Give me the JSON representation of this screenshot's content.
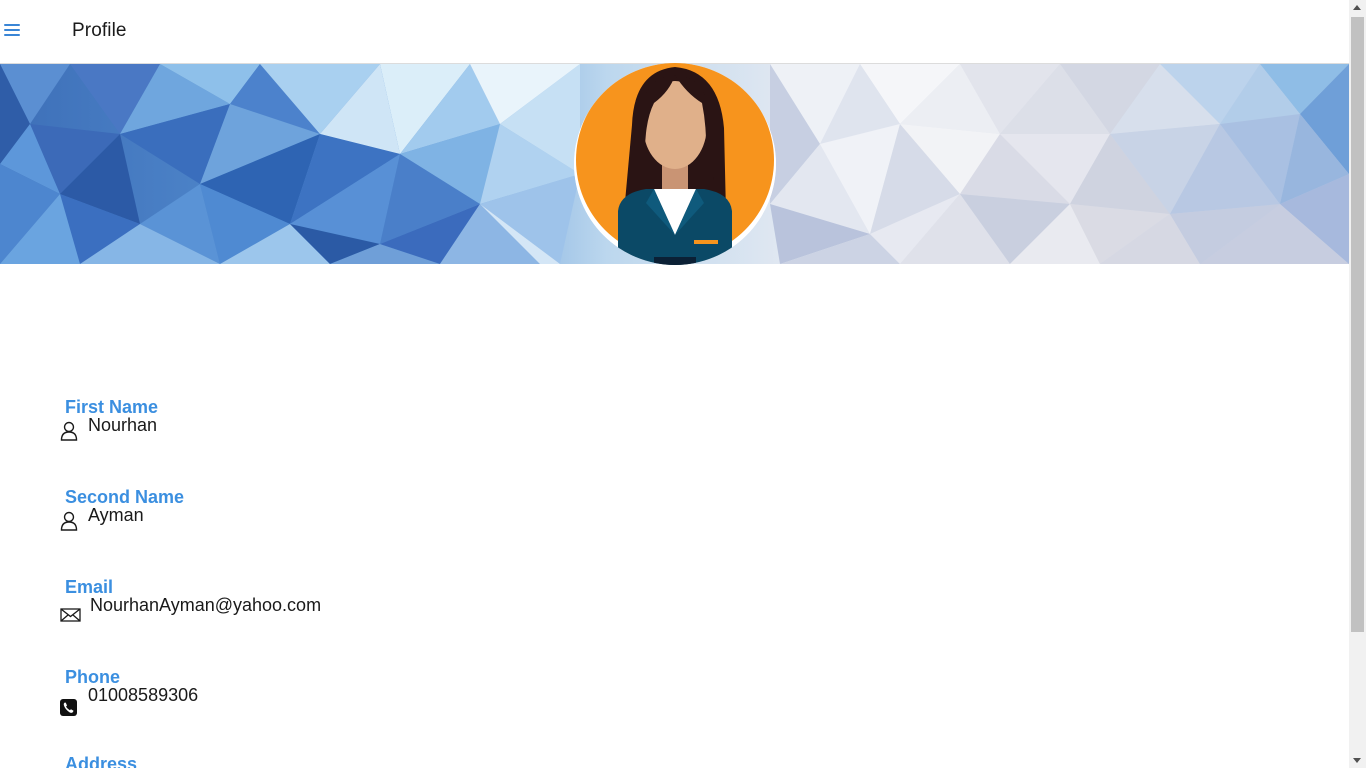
{
  "header": {
    "title": "Profile",
    "menu_icon": "hamburger-menu-icon"
  },
  "colors": {
    "accent": "#3b8fe0",
    "menu_icon": "#3a86d6",
    "avatar_bg": "#f7941d"
  },
  "profile": {
    "avatar_icon": "female-avatar-icon",
    "fields": [
      {
        "label": "First Name",
        "value": "Nourhan",
        "icon": "user-icon"
      },
      {
        "label": "Second Name",
        "value": "Ayman",
        "icon": "user-icon"
      },
      {
        "label": "Email",
        "value": "NourhanAyman@yahoo.com",
        "icon": "envelope-icon"
      },
      {
        "label": "Phone",
        "value": "01008589306",
        "icon": "phone-icon"
      },
      {
        "label": "Address",
        "value": "",
        "icon": ""
      }
    ]
  }
}
